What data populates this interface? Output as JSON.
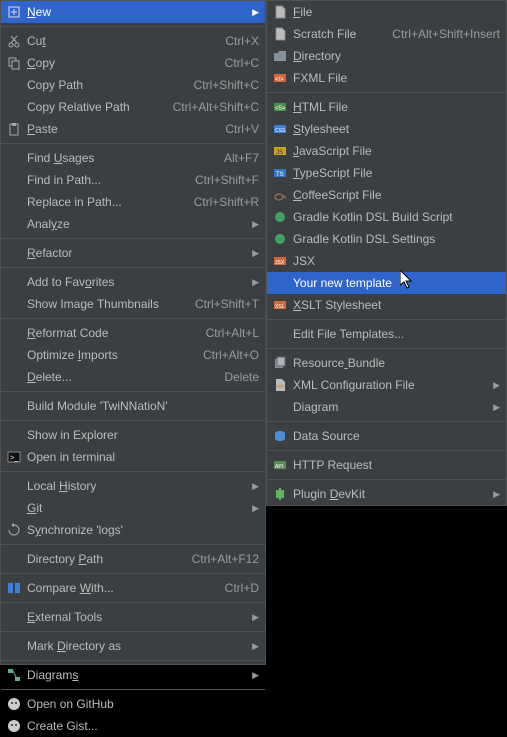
{
  "left_menu": {
    "items": [
      {
        "label": "New",
        "icon": "new",
        "arrow": true,
        "hl": true,
        "u": 0
      },
      {
        "sep": true
      },
      {
        "label": "Cut",
        "shortcut": "Ctrl+X",
        "icon": "cut",
        "u": 2
      },
      {
        "label": "Copy",
        "shortcut": "Ctrl+C",
        "icon": "copy",
        "u": 0
      },
      {
        "label": "Copy Path",
        "shortcut": "Ctrl+Shift+C",
        "icon": ""
      },
      {
        "label": "Copy Relative Path",
        "shortcut": "Ctrl+Alt+Shift+C",
        "icon": ""
      },
      {
        "label": "Paste",
        "shortcut": "Ctrl+V",
        "icon": "paste",
        "u": 0
      },
      {
        "sep": true
      },
      {
        "label": "Find Usages",
        "shortcut": "Alt+F7",
        "icon": "",
        "u": 5
      },
      {
        "label": "Find in Path...",
        "shortcut": "Ctrl+Shift+F",
        "icon": ""
      },
      {
        "label": "Replace in Path...",
        "shortcut": "Ctrl+Shift+R",
        "icon": ""
      },
      {
        "label": "Analyze",
        "icon": "",
        "arrow": true,
        "u": 4
      },
      {
        "sep": true
      },
      {
        "label": "Refactor",
        "icon": "",
        "arrow": true,
        "u": 0
      },
      {
        "sep": true
      },
      {
        "label": "Add to Favorites",
        "icon": "",
        "arrow": true,
        "u": 10
      },
      {
        "label": "Show Image Thumbnails",
        "shortcut": "Ctrl+Shift+T",
        "icon": ""
      },
      {
        "sep": true
      },
      {
        "label": "Reformat Code",
        "shortcut": "Ctrl+Alt+L",
        "icon": "",
        "u": 0
      },
      {
        "label": "Optimize Imports",
        "shortcut": "Ctrl+Alt+O",
        "icon": "",
        "u": 9
      },
      {
        "label": "Delete...",
        "shortcut": "Delete",
        "icon": "",
        "u": 0
      },
      {
        "sep": true
      },
      {
        "label": "Build Module 'TwiNNatioN'",
        "icon": ""
      },
      {
        "sep": true
      },
      {
        "label": "Show in Explorer",
        "icon": ""
      },
      {
        "label": "Open in terminal",
        "icon": "terminal"
      },
      {
        "sep": true
      },
      {
        "label": "Local History",
        "icon": "",
        "arrow": true,
        "u": 6
      },
      {
        "label": "Git",
        "icon": "",
        "arrow": true,
        "u": 0
      },
      {
        "label": "Synchronize 'logs'",
        "icon": "sync",
        "u": 1
      },
      {
        "sep": true
      },
      {
        "label": "Directory Path",
        "shortcut": "Ctrl+Alt+F12",
        "icon": "",
        "u": 10
      },
      {
        "sep": true
      },
      {
        "label": "Compare With...",
        "shortcut": "Ctrl+D",
        "icon": "diff",
        "u": 8
      },
      {
        "sep": true
      },
      {
        "label": "External Tools",
        "icon": "",
        "arrow": true,
        "u": 0
      },
      {
        "sep": true
      },
      {
        "label": "Mark Directory as",
        "icon": "",
        "arrow": true,
        "u": 5
      },
      {
        "sep": true
      },
      {
        "label": "Diagrams",
        "icon": "diagram",
        "arrow": true,
        "u": 7
      },
      {
        "sep": true
      },
      {
        "label": "Open on GitHub",
        "icon": "github"
      },
      {
        "label": "Create Gist...",
        "icon": "github"
      }
    ]
  },
  "right_menu": {
    "items": [
      {
        "label": "File",
        "icon": "file",
        "u": 0
      },
      {
        "label": "Scratch File",
        "shortcut": "Ctrl+Alt+Shift+Insert",
        "icon": "file"
      },
      {
        "label": "Directory",
        "icon": "folder",
        "u": 0
      },
      {
        "label": "FXML File",
        "icon": "fxml"
      },
      {
        "sep": true
      },
      {
        "label": "HTML File",
        "icon": "html",
        "u": 0
      },
      {
        "label": "Stylesheet",
        "icon": "css",
        "u": 0
      },
      {
        "label": "JavaScript File",
        "icon": "js",
        "u": 0
      },
      {
        "label": "TypeScript File",
        "icon": "ts",
        "u": 0
      },
      {
        "label": "CoffeeScript File",
        "icon": "coffee",
        "u": 0
      },
      {
        "label": "Gradle Kotlin DSL Build Script",
        "icon": "gradle"
      },
      {
        "label": "Gradle Kotlin DSL Settings",
        "icon": "gradle"
      },
      {
        "label": "JSX",
        "icon": "jsx"
      },
      {
        "label": "Your new template",
        "icon": "",
        "hl": true
      },
      {
        "label": "XSLT Stylesheet",
        "icon": "xsl",
        "u": 0
      },
      {
        "sep": true
      },
      {
        "label": "Edit File Templates...",
        "icon": ""
      },
      {
        "sep": true
      },
      {
        "label": "Resource Bundle",
        "icon": "bundle",
        "u": 8
      },
      {
        "label": "XML Configuration File",
        "icon": "xml",
        "arrow": true
      },
      {
        "label": "Diagram",
        "icon": "",
        "arrow": true
      },
      {
        "sep": true
      },
      {
        "label": "Data Source",
        "icon": "db"
      },
      {
        "sep": true
      },
      {
        "label": "HTTP Request",
        "icon": "api"
      },
      {
        "sep": true
      },
      {
        "label": "Plugin DevKit",
        "icon": "plugin",
        "arrow": true,
        "u": 7
      }
    ]
  }
}
